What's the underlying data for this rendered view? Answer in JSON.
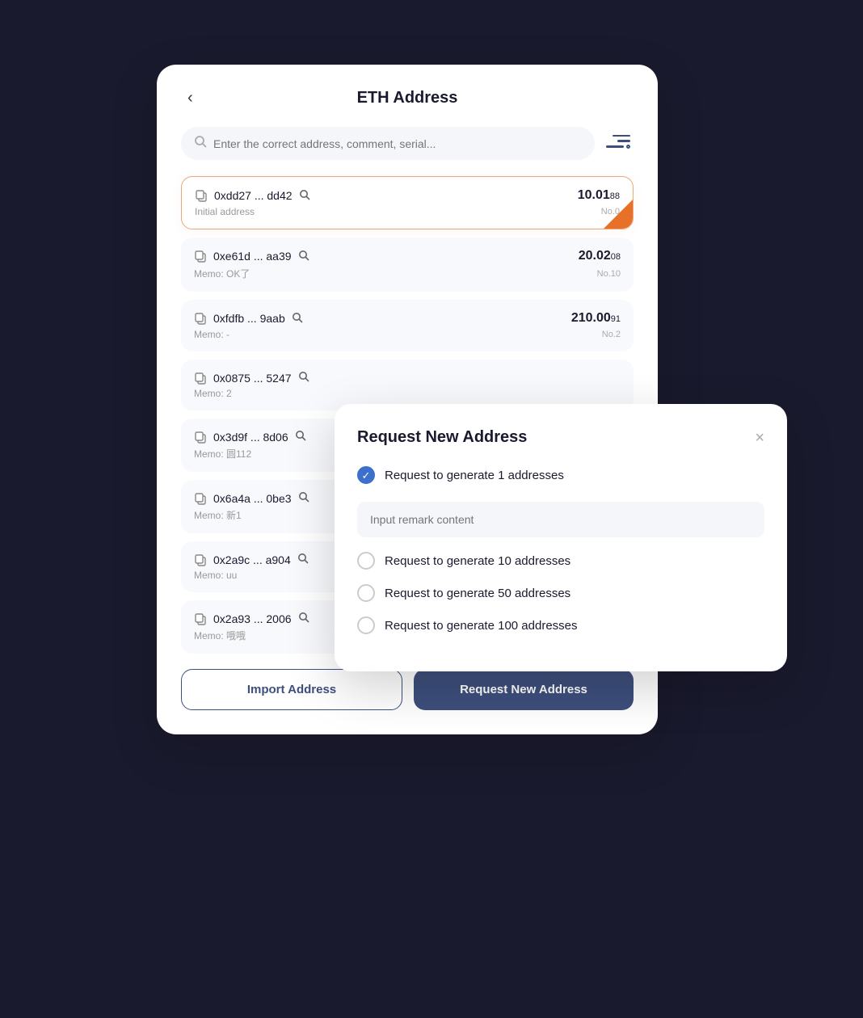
{
  "header": {
    "title": "ETH Address",
    "back_label": "‹"
  },
  "search": {
    "placeholder": "Enter the correct address, comment, serial..."
  },
  "addresses": [
    {
      "id": "addr-0",
      "short": "0xdd27 ... dd42",
      "memo": "Initial address",
      "amount_main": "10.01",
      "amount_small": "88",
      "no": "No.0",
      "active": true
    },
    {
      "id": "addr-10",
      "short": "0xe61d ... aa39",
      "memo": "Memo: OK了",
      "amount_main": "20.02",
      "amount_small": "08",
      "no": "No.10",
      "active": false
    },
    {
      "id": "addr-2",
      "short": "0xfdfb ... 9aab",
      "memo": "Memo: -",
      "amount_main": "210.00",
      "amount_small": "91",
      "no": "No.2",
      "active": false
    },
    {
      "id": "addr-x1",
      "short": "0x0875 ... 5247",
      "memo": "Memo: 2",
      "amount_main": "",
      "amount_small": "",
      "no": "",
      "active": false
    },
    {
      "id": "addr-x2",
      "short": "0x3d9f ... 8d06",
      "memo": "Memo: 圆112",
      "amount_main": "",
      "amount_small": "",
      "no": "",
      "active": false
    },
    {
      "id": "addr-x3",
      "short": "0x6a4a ... 0be3",
      "memo": "Memo: 新1",
      "amount_main": "",
      "amount_small": "",
      "no": "",
      "active": false
    },
    {
      "id": "addr-x4",
      "short": "0x2a9c ... a904",
      "memo": "Memo: uu",
      "amount_main": "",
      "amount_small": "",
      "no": "",
      "active": false
    },
    {
      "id": "addr-x5",
      "short": "0x2a93 ... 2006",
      "memo": "Memo: 哦哦",
      "amount_main": "",
      "amount_small": "",
      "no": "",
      "active": false
    }
  ],
  "buttons": {
    "import": "Import Address",
    "request": "Request New Address"
  },
  "modal": {
    "title": "Request New Address",
    "close_label": "×",
    "remark_placeholder": "Input remark content",
    "options": [
      {
        "id": "opt-1",
        "label": "Request to generate 1 addresses",
        "checked": true
      },
      {
        "id": "opt-10",
        "label": "Request to generate 10 addresses",
        "checked": false
      },
      {
        "id": "opt-50",
        "label": "Request to generate 50 addresses",
        "checked": false
      },
      {
        "id": "opt-100",
        "label": "Request to generate 100 addresses",
        "checked": false
      }
    ]
  }
}
